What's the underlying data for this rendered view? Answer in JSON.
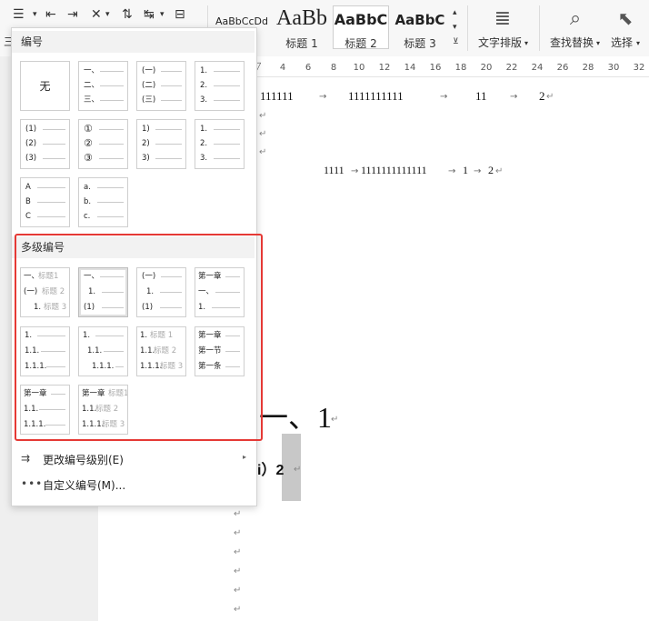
{
  "ribbon": {
    "styles": [
      {
        "preview": "AaBbCcDd",
        "label": ""
      },
      {
        "preview": "AaBb",
        "label": "标题 1"
      },
      {
        "preview": "AaBbC",
        "label": "标题 2"
      },
      {
        "preview": "AaBbC",
        "label": "标题 3"
      }
    ],
    "text_layout_label": "文字排版",
    "find_replace_label": "查找替换",
    "select_label": "选择",
    "left_glyph": "三"
  },
  "ruler_ticks": [
    "2",
    "4",
    "6",
    "8",
    "10",
    "12",
    "14",
    "16",
    "18",
    "20",
    "22",
    "24",
    "26",
    "28",
    "30",
    "32"
  ],
  "document": {
    "line1": [
      "111111",
      "1111111111",
      "11",
      "2"
    ],
    "line2": [
      "1111",
      "1111111111111",
      "1",
      "2"
    ],
    "heading": "一、1",
    "subheading": "i）2",
    "para_mark": "↵",
    "tab_arrow": "→"
  },
  "menu": {
    "section_numbering": "编号",
    "none_label": "无",
    "single": [
      [
        "一、",
        "二、",
        "三、"
      ],
      [
        "(一)",
        "(二)",
        "(三)"
      ],
      [
        "1.",
        "2.",
        "3."
      ],
      [
        "(1)",
        "(2)",
        "(3)"
      ],
      [
        "①",
        "②",
        "③"
      ],
      [
        "1)",
        "2)",
        "3)"
      ],
      [
        "1.",
        "2.",
        "3."
      ],
      [
        "A",
        "B",
        "C"
      ],
      [
        "a.",
        "b.",
        "c."
      ]
    ],
    "section_multilevel": "多级编号",
    "multi": [
      [
        [
          "一、",
          "标题1"
        ],
        [
          "(一)",
          "标题 2"
        ],
        [
          "1.",
          "标题 3"
        ]
      ],
      [
        [
          "一、",
          ""
        ],
        [
          "1.",
          ""
        ],
        [
          "(1)",
          ""
        ]
      ],
      [
        [
          "(一)",
          ""
        ],
        [
          "1.",
          ""
        ],
        [
          "(1)",
          ""
        ]
      ],
      [
        [
          "第一章",
          ""
        ],
        [
          "一、",
          ""
        ],
        [
          "1.",
          ""
        ]
      ],
      [
        [
          "1.",
          ""
        ],
        [
          "1.1.",
          ""
        ],
        [
          "1.1.1.",
          ""
        ]
      ],
      [
        [
          "1.",
          ""
        ],
        [
          "1.1.",
          ""
        ],
        [
          "1.1.1.",
          ""
        ]
      ],
      [
        [
          "1.",
          "标题 1"
        ],
        [
          "1.1.",
          "标题 2"
        ],
        [
          "1.1.1.",
          "标题 3"
        ]
      ],
      [
        [
          "第一章",
          ""
        ],
        [
          "第一节",
          ""
        ],
        [
          "第一条",
          ""
        ]
      ],
      [
        [
          "第一章",
          ""
        ],
        [
          "1.1.",
          ""
        ],
        [
          "1.1.1.",
          ""
        ]
      ],
      [
        [
          "第一章",
          "标题1"
        ],
        [
          "1.1.",
          "标题 2"
        ],
        [
          "1.1.1.",
          "标题 3"
        ]
      ]
    ],
    "change_level_label": "更改编号级别(E)",
    "custom_label": "自定义编号(M)..."
  }
}
